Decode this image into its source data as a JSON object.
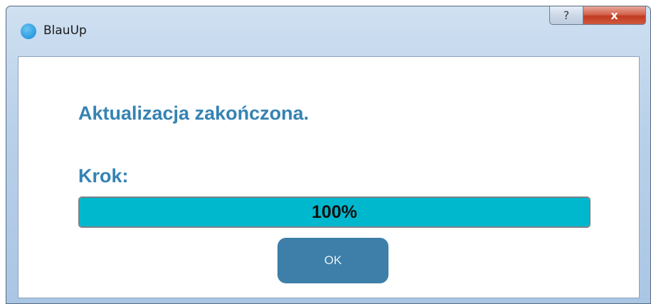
{
  "window": {
    "title": "BlauUp",
    "help_glyph": "?",
    "close_glyph": "x",
    "icon": "blue-circle-app-icon"
  },
  "main": {
    "heading": "Aktualizacja zakończona.",
    "step_label": "Krok:",
    "progress": {
      "value": 100,
      "text": "100%",
      "fill_color": "#00b8ce"
    },
    "ok_label": "OK"
  },
  "colors": {
    "accent_text": "#3583b3",
    "button": "#3d7fa9"
  }
}
